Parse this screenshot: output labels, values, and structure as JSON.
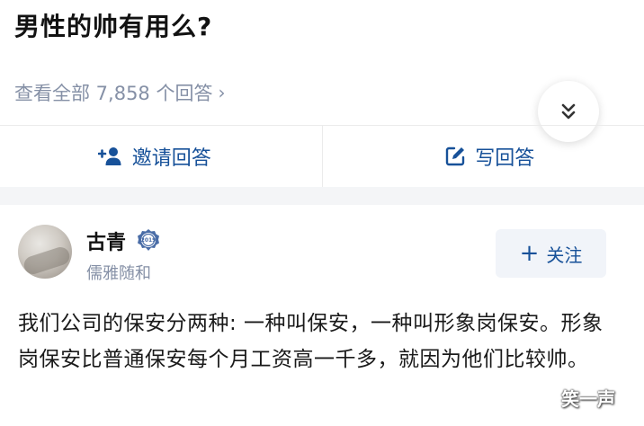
{
  "question": {
    "title": "男性的帅有用么?"
  },
  "answers_link": {
    "label": "查看全部 7,858 个回答"
  },
  "icons": {
    "expand": "double-chevron-down-icon",
    "invite": "add-person-icon",
    "write": "edit-square-icon",
    "badge": "badge-icon",
    "follow": "plus-icon"
  },
  "actions": {
    "invite_label": "邀请回答",
    "write_label": "写回答"
  },
  "answer": {
    "author_name": "古青",
    "author_bio": "儒雅随和",
    "badge_text": "2019",
    "follow_label": "关注",
    "content": "我们公司的保安分两种: 一种叫保安，一种叫形象岗保安。形象岗保安比普通保安每个月工资高一千多，就因为他们比较帅。"
  },
  "watermark": "笑一声",
  "colors": {
    "accent": "#175199",
    "muted": "#8590a6",
    "follow_bg": "#f1f4f9",
    "band_bg": "#f4f5f7"
  }
}
